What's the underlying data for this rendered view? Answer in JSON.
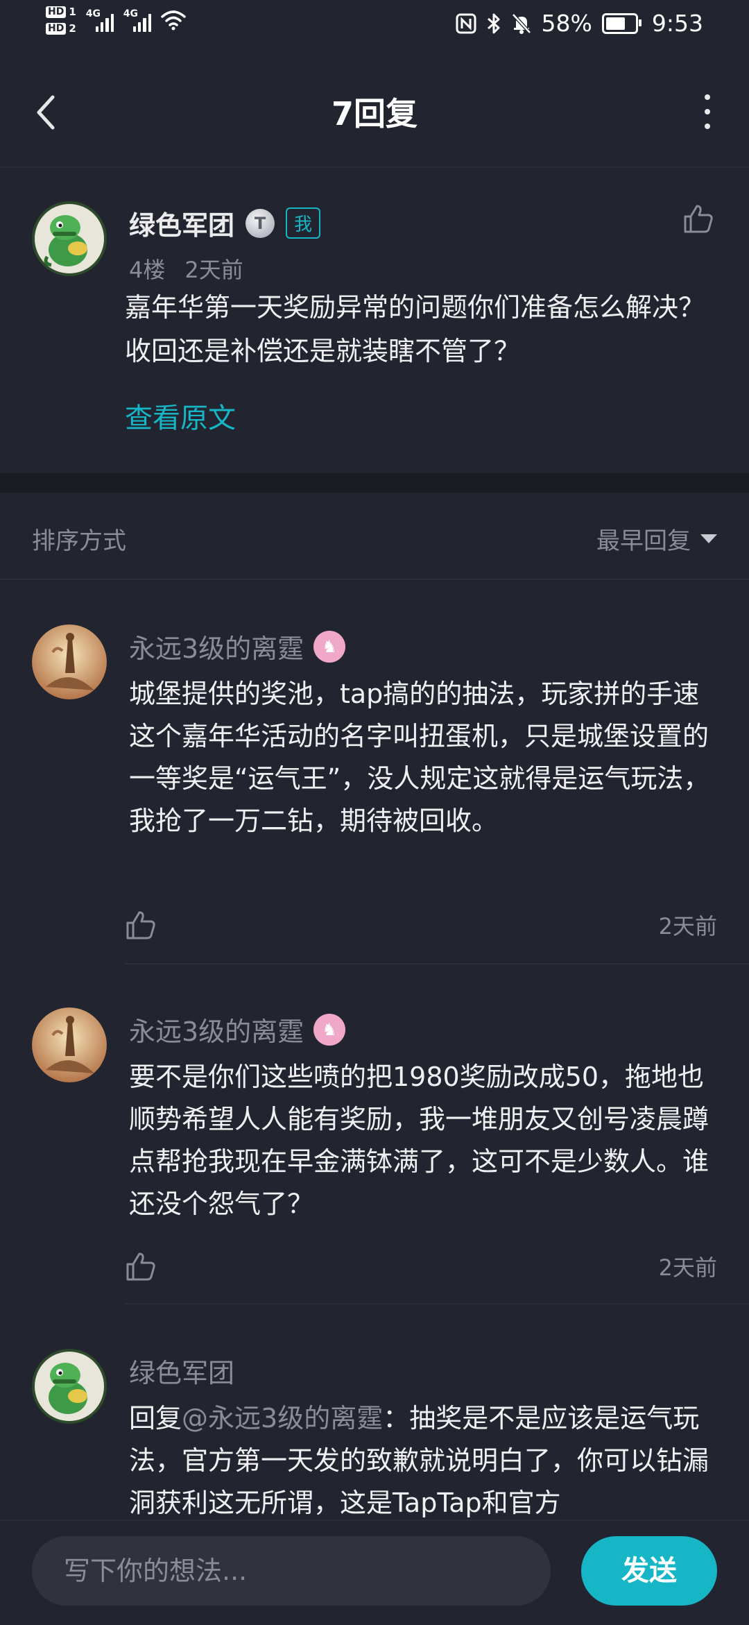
{
  "status_bar": {
    "hd1": "HD",
    "hd1_sim": "1",
    "hd2": "HD",
    "hd2_sim": "2",
    "net1": "4G",
    "net2": "4G",
    "battery": "58%",
    "battery_level": 0.58,
    "time": "9:53",
    "icons": [
      "signal-icon",
      "signal-icon",
      "wifi-icon",
      "nfc-icon",
      "bluetooth-icon",
      "mute-bell-icon",
      "battery-icon"
    ]
  },
  "header": {
    "title": "7回复",
    "back_icon": "chevron-left-icon",
    "more_icon": "more-vertical-icon"
  },
  "post": {
    "author": "绿色军团",
    "level_badge": "T",
    "me_tag": "我",
    "floor": "4楼",
    "time": "2天前",
    "body": "嘉年华第一天奖励异常的问题你们准备怎么解决？收回还是补偿还是就装瞎不管了？",
    "view_original": "查看原文"
  },
  "sort": {
    "label": "排序方式",
    "selected": "最早回复"
  },
  "replies": [
    {
      "author": "永远3级的离霆",
      "body": "城堡提供的奖池，tap搞的的抽法，玩家拼的手速\n这个嘉年华活动的名字叫扭蛋机，只是城堡设置的一等奖是“运气王”，没人规定这就得是运气玩法，我抢了一万二钻，期待被回收。",
      "time": "2天前"
    },
    {
      "author": "永远3级的离霆",
      "body": "要不是你们这些喷的把1980奖励改成50，拖地也顺势希望人人能有奖励，我一堆朋友又创号凌晨蹲点帮抢我现在早金满钵满了，这可不是少数人。谁还没个怨气了？",
      "time": "2天前"
    },
    {
      "author": "绿色军团",
      "reply_prefix": "回复",
      "reply_to": "@永远3级的离霆",
      "body": "：抽奖是不是应该是运气玩法，官方第一天发的致歉就说明白了，你可以钻漏洞获利这无所谓，这是TapTap和官方"
    }
  ],
  "composer": {
    "placeholder": "写下你的想法...",
    "send_label": "发送"
  },
  "colors": {
    "accent": "#17b6c7",
    "background": "#22252f",
    "muted": "#8a8d96"
  }
}
